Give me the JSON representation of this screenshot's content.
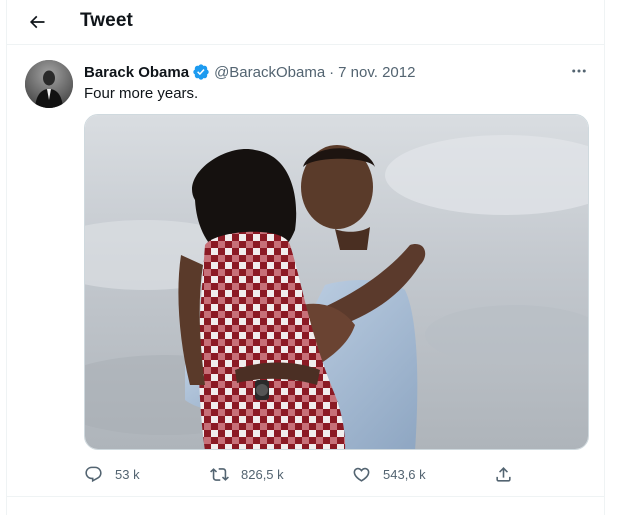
{
  "header": {
    "title": "Tweet",
    "back_icon": "arrow-left-icon"
  },
  "tweet": {
    "author_name": "Barack Obama",
    "verified": true,
    "handle": "@BarackObama",
    "separator": "·",
    "date": "7 nov. 2012",
    "text": "Four more years.",
    "more_icon": "more-horizontal-icon"
  },
  "actions": {
    "reply_count": "53 k",
    "retweet_count": "826,5 k",
    "like_count": "543,6 k"
  },
  "colors": {
    "text": "#0f1419",
    "secondary": "#536471",
    "verified": "#1d9bf0",
    "border": "#eff3f4"
  }
}
